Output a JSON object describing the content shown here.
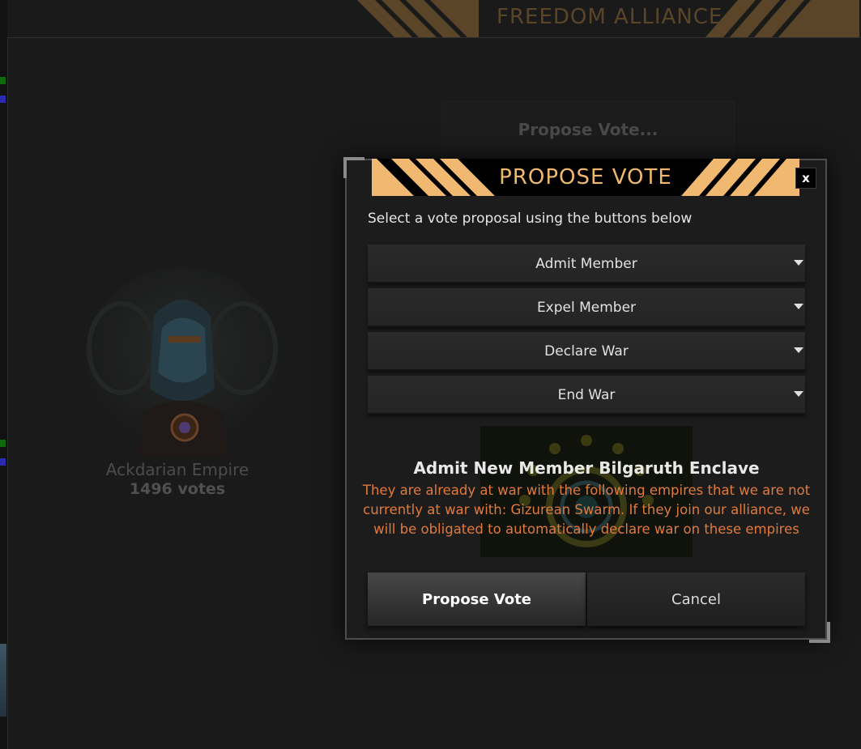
{
  "background": {
    "title": "FREEDOM ALLIANCE",
    "propose_hint": "Propose Vote...",
    "empire": {
      "name": "Ackdarian Empire",
      "votes": "1496 votes"
    }
  },
  "dialog": {
    "title": "PROPOSE VOTE",
    "close_label": "x",
    "instruction": "Select a vote proposal using the buttons below",
    "options": [
      {
        "label": "Admit Member"
      },
      {
        "label": "Expel Member"
      },
      {
        "label": "Declare War"
      },
      {
        "label": "End War"
      }
    ],
    "proposal": {
      "title": "Admit New Member Bilgaruth Enclave",
      "warning": "They are already at war with the following empires that we are not currently at war with: Gizurean Swarm. If they join our alliance, we will be obligated to automatically declare war on these empires"
    },
    "buttons": {
      "propose": "Propose Vote",
      "cancel": "Cancel"
    }
  },
  "colors": {
    "accent_orange": "#f0b870",
    "warning_orange": "#e07a3c",
    "stripe_dim": "#5a4529"
  }
}
